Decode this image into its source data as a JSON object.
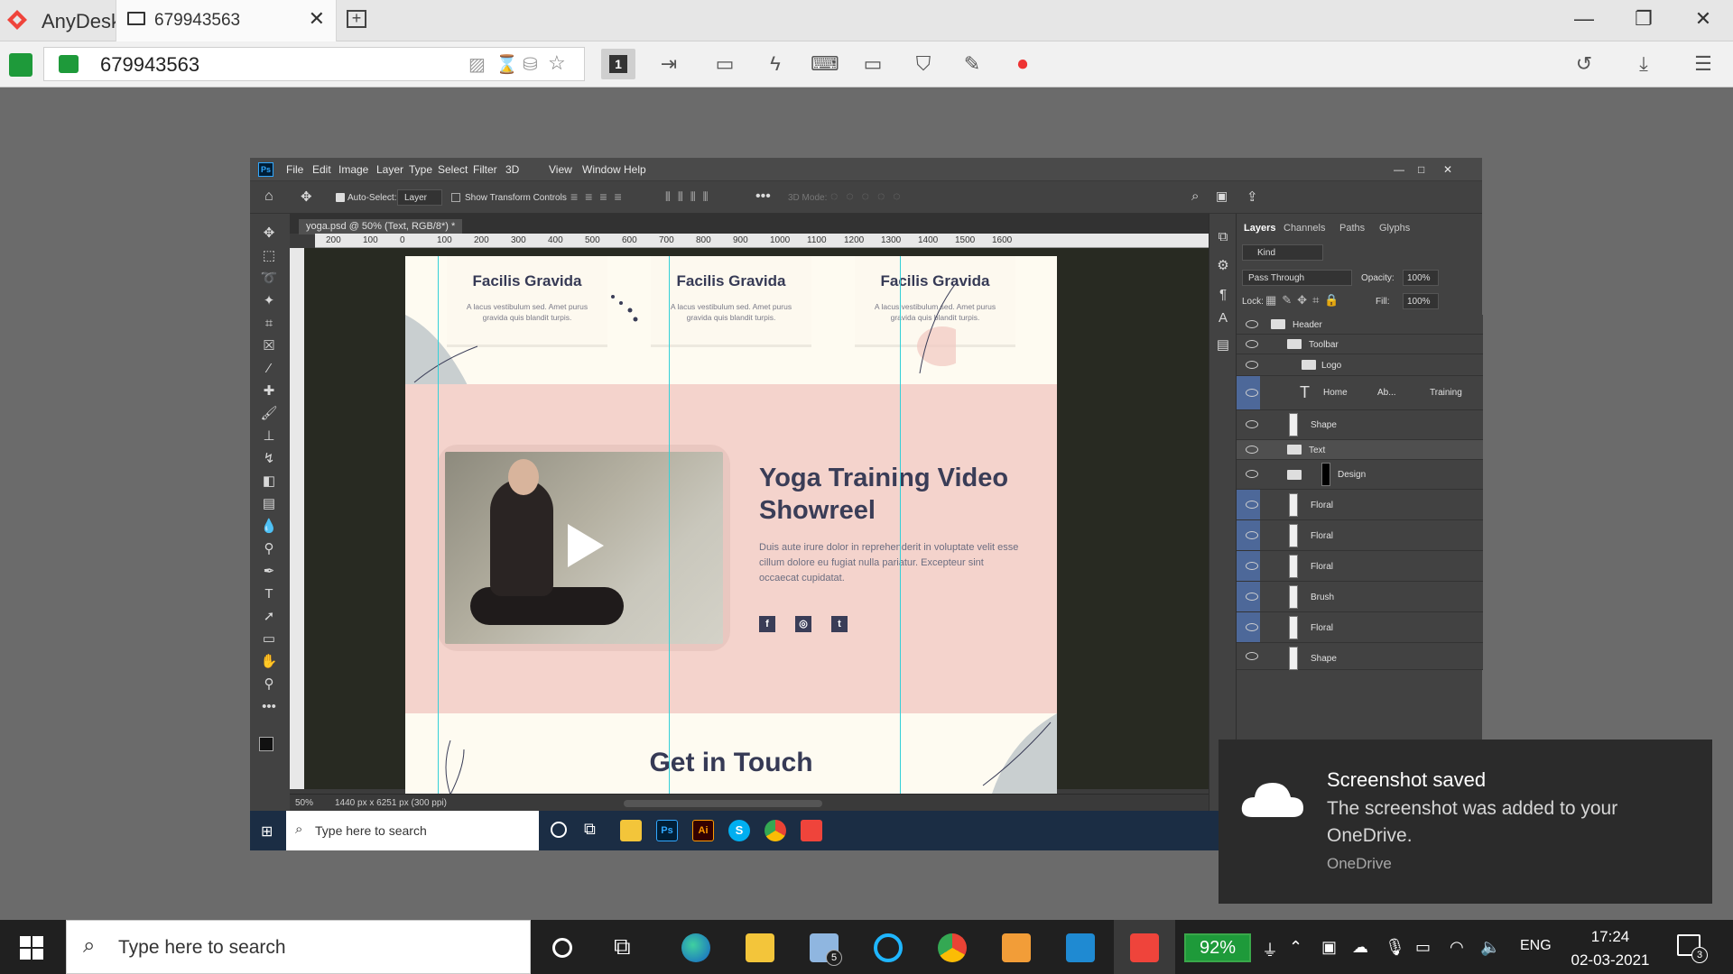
{
  "anydesk": {
    "app_name": "AnyDesk",
    "tab_id": "679943563",
    "address": "679943563",
    "monitor": "1"
  },
  "photoshop": {
    "logo": "Ps",
    "menu": [
      "File",
      "Edit",
      "Image",
      "Layer",
      "Type",
      "Select",
      "Filter",
      "3D",
      "View",
      "Window",
      "Help"
    ],
    "options": {
      "auto_select": "Auto-Select:",
      "layer_dropdown": "Layer",
      "show_transform": "Show Transform Controls",
      "mode_3d": "3D Mode:"
    },
    "doc_tab": "yoga.psd @ 50% (Text, RGB/8*) *",
    "ruler": [
      "200",
      "100",
      "0",
      "100",
      "200",
      "300",
      "400",
      "500",
      "600",
      "700",
      "800",
      "900",
      "1000",
      "1100",
      "1200",
      "1300",
      "1400",
      "1500",
      "1600"
    ],
    "status": {
      "zoom": "50%",
      "size": "1440 px x 6251 px (300 ppi)"
    },
    "panel_tabs": [
      "Layers",
      "Channels",
      "Paths",
      "Glyphs"
    ],
    "kind": "Kind",
    "blend_mode": "Pass Through",
    "opacity_label": "Opacity:",
    "opacity": "100%",
    "lock_label": "Lock:",
    "fill_label": "Fill:",
    "fill": "100%",
    "layers": [
      {
        "name": "Header",
        "type": "group"
      },
      {
        "name": "Toolbar",
        "type": "group"
      },
      {
        "name": "Logo",
        "type": "group"
      },
      {
        "name": "Home",
        "extra1": "Ab...",
        "extra2": "Training",
        "type": "text"
      },
      {
        "name": "Shape",
        "type": "shape"
      },
      {
        "name": "Text",
        "type": "group"
      },
      {
        "name": "Design",
        "type": "group"
      },
      {
        "name": "Floral",
        "type": "shape"
      },
      {
        "name": "Floral",
        "type": "shape"
      },
      {
        "name": "Floral",
        "type": "shape"
      },
      {
        "name": "Brush",
        "type": "shape"
      },
      {
        "name": "Floral",
        "type": "shape"
      },
      {
        "name": "Shape",
        "type": "shape"
      }
    ]
  },
  "design": {
    "cards": [
      {
        "title": "Facilis Gravida",
        "body": "A lacus vestibulum sed. Amet purus gravida quis blandit turpis."
      },
      {
        "title": "Facilis Gravida",
        "body": "A lacus vestibulum sed. Amet purus gravida quis blandit turpis."
      },
      {
        "title": "Facilis Gravida",
        "body": "A lacus vestibulum sed. Amet purus gravida quis blandit turpis."
      }
    ],
    "video_title": "Yoga Training Video Showreel",
    "video_body": "Duis aute irure dolor in reprehenderit in voluptate velit esse cillum dolore eu fugiat nulla pariatur. Excepteur sint occaecat cupidatat.",
    "social": [
      "f",
      "◎",
      "t"
    ],
    "touch_title": "Get in Touch"
  },
  "remote_taskbar": {
    "search_placeholder": "Type here to search"
  },
  "toast": {
    "title": "Screenshot saved",
    "body": "The screenshot was added to your OneDrive.",
    "app": "OneDrive"
  },
  "taskbar": {
    "search_placeholder": "Type here to search",
    "mail_badge": "5",
    "battery": "92%",
    "language": "ENG",
    "time": "17:24",
    "date": "02-03-2021",
    "notifications": "3"
  },
  "colors": {
    "anydesk_red": "#ef443b",
    "ps_bg": "#424242",
    "pink_section": "#f4d3cc",
    "guide": "#35d0d8",
    "navy_text": "#363a55"
  }
}
